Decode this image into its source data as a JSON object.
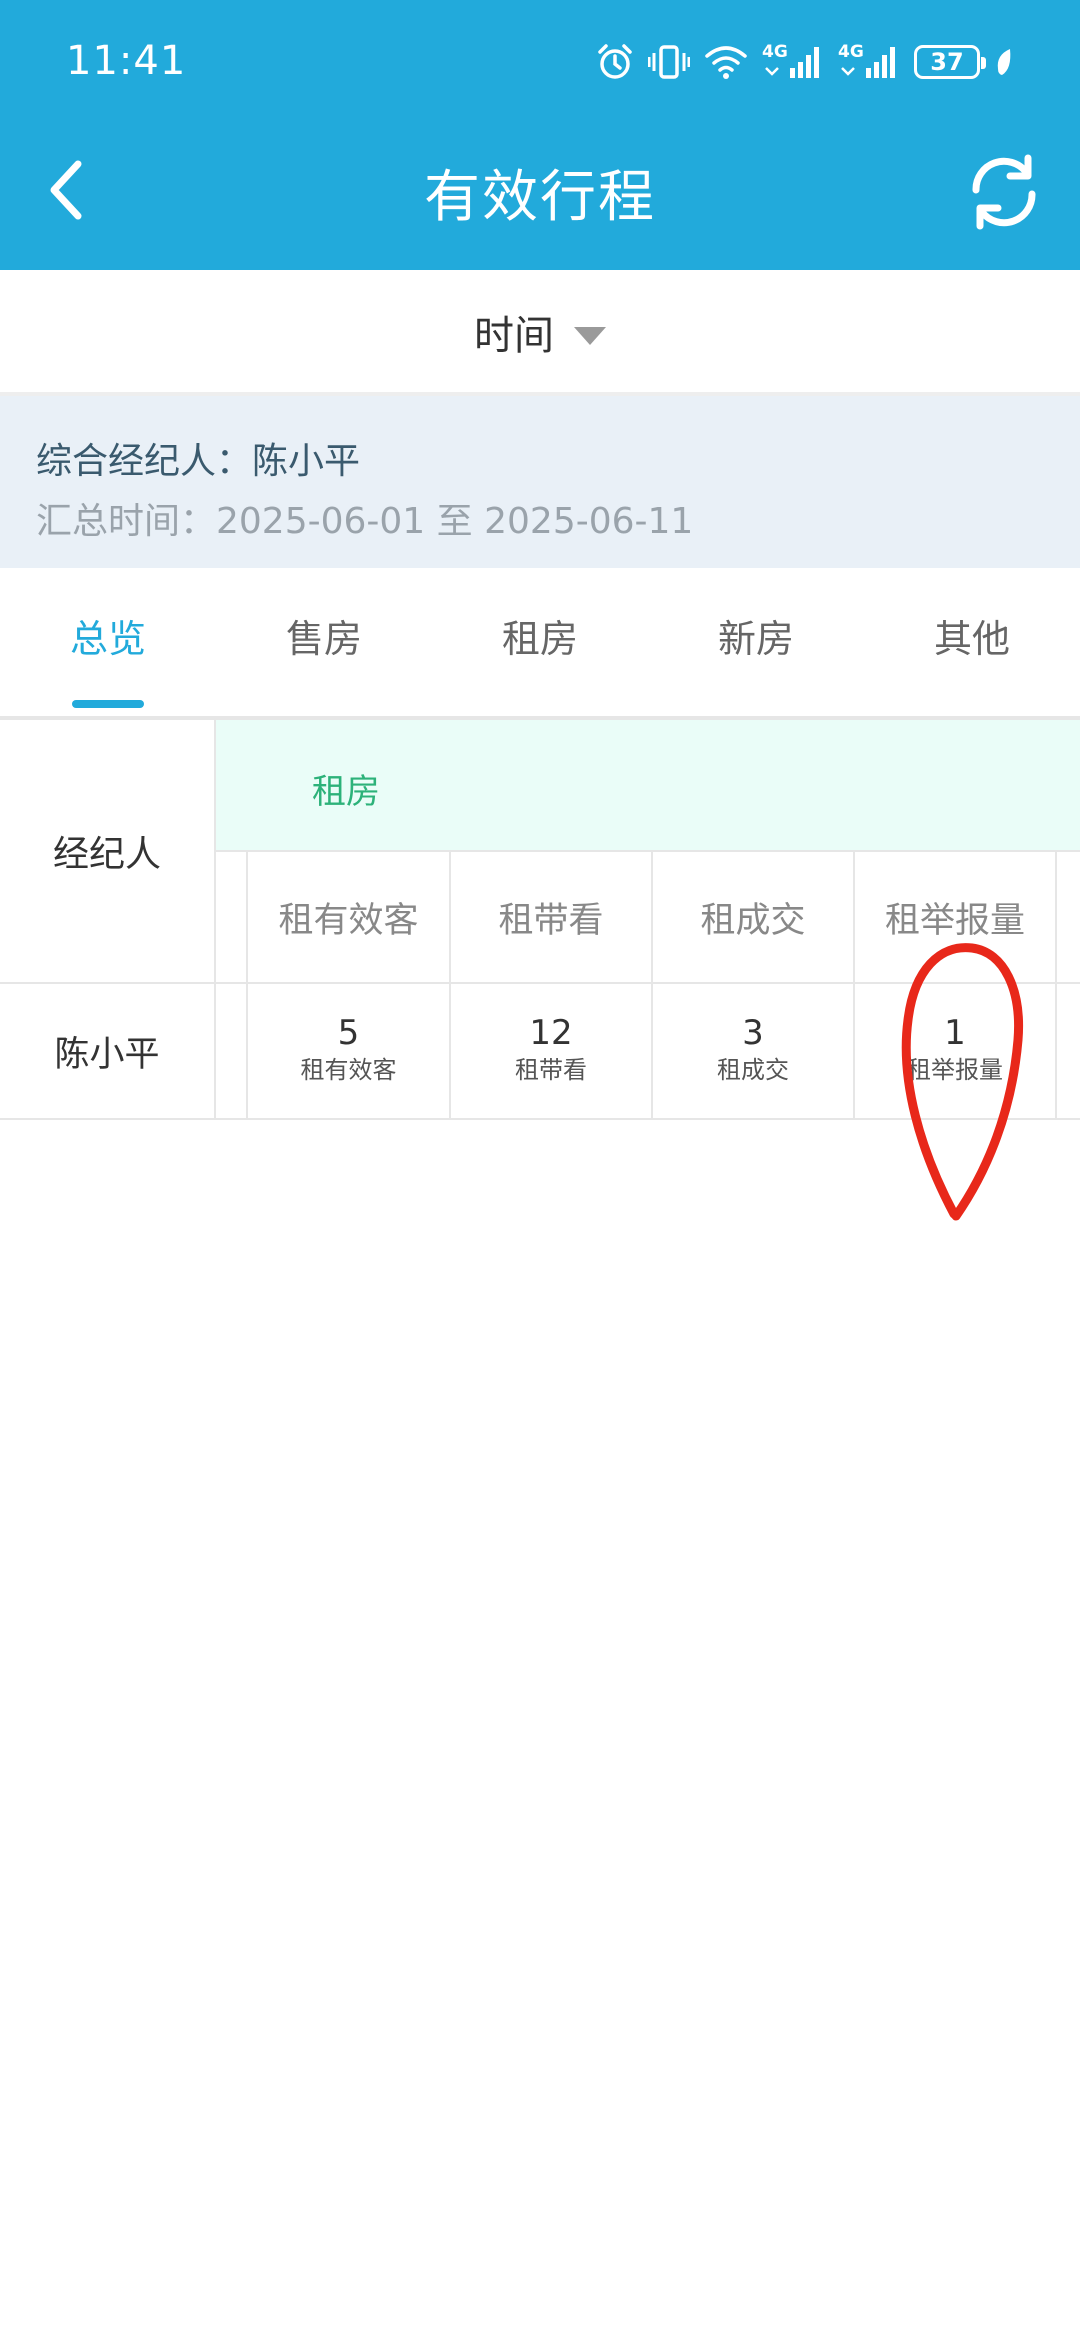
{
  "status_bar": {
    "time": "11:41",
    "network_4g_1": "4G",
    "network_4g_2": "4G",
    "battery": "37"
  },
  "header": {
    "title": "有效行程"
  },
  "filter": {
    "time_label": "时间"
  },
  "summary": {
    "agent_line": "综合经纪人：陈小平",
    "period_line": "汇总时间：2025-06-01 至 2025-06-11"
  },
  "tabs": [
    {
      "label": "总览",
      "active": true
    },
    {
      "label": "售房",
      "active": false
    },
    {
      "label": "租房",
      "active": false
    },
    {
      "label": "新房",
      "active": false
    },
    {
      "label": "其他",
      "active": false
    }
  ],
  "table": {
    "agent_header": "经纪人",
    "group_header": "租房",
    "columns": [
      "租有效客",
      "租带看",
      "租成交",
      "租举报量"
    ],
    "rows": [
      {
        "agent": "陈小平",
        "cells": [
          {
            "value": "5",
            "label": "租有效客"
          },
          {
            "value": "12",
            "label": "租带看"
          },
          {
            "value": "3",
            "label": "租成交"
          },
          {
            "value": "1",
            "label": "租举报量"
          }
        ]
      }
    ]
  },
  "colors": {
    "primary": "#22aadb",
    "group_header_bg": "#eafdf8",
    "group_header_text": "#2db27a",
    "summary_bg": "#e9f0f7",
    "annotation": "#e8281a"
  }
}
